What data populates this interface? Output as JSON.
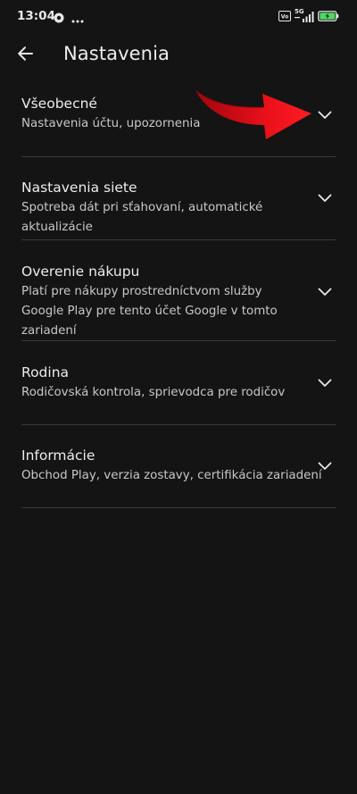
{
  "status_bar": {
    "time": "13:04",
    "network_label": "5G",
    "icons": [
      "app-notification-icon",
      "more-dots-icon",
      "volte-icon",
      "signal-icon",
      "battery-charging-icon"
    ]
  },
  "app_bar": {
    "back_icon": "arrow-back-icon",
    "title": "Nastavenia"
  },
  "settings": {
    "items": [
      {
        "title": "Všeobecné",
        "subtitle": "Nastavenia účtu, upozornenia",
        "icon": "chevron-down-icon"
      },
      {
        "title": "Nastavenia siete",
        "subtitle": "Spotreba dát pri sťahovaní, automatické aktualizácie",
        "icon": "chevron-down-icon"
      },
      {
        "title": "Overenie nákupu",
        "subtitle": "Platí pre nákupy prostredníctvom služby Google Play pre tento účet Google v tomto zariadení",
        "icon": "chevron-down-icon"
      },
      {
        "title": "Rodina",
        "subtitle": "Rodičovská kontrola, sprievodca pre rodičov",
        "icon": "chevron-down-icon"
      },
      {
        "title": "Informácie",
        "subtitle": "Obchod Play, verzia zostavy, certifikácia zariadení",
        "icon": "chevron-down-icon"
      }
    ]
  },
  "colors": {
    "background": "#141414",
    "text_primary": "#ececec",
    "text_secondary": "#c8c8c8",
    "divider": "#3a3a3a",
    "annotation_arrow": "#e8101a",
    "battery_charge": "#4cd964"
  }
}
